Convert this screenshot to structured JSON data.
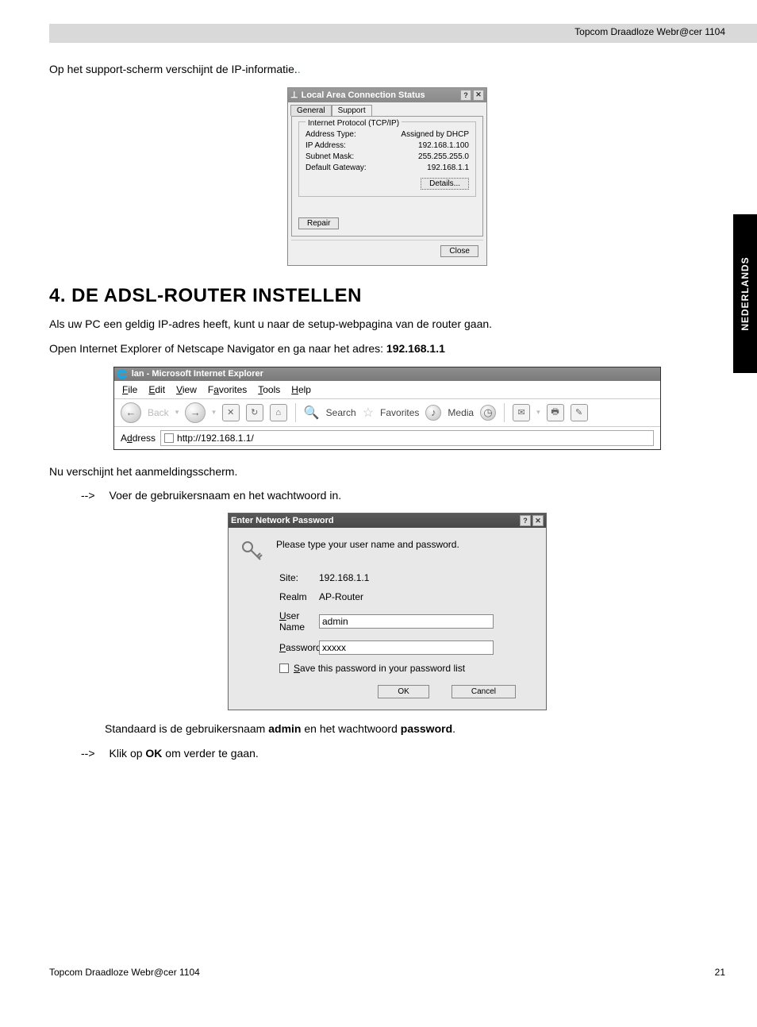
{
  "header": {
    "product": "Topcom Draadloze Webr@cer 1104"
  },
  "sideTab": "NEDERLANDS",
  "intro": {
    "support_line_a": "Op het support-scherm verschijnt de IP-informatie.",
    "support_line_dots": "."
  },
  "dlg1": {
    "title": "Local Area Connection Status",
    "tab_general": "General",
    "tab_support": "Support",
    "legend": "Internet Protocol (TCP/IP)",
    "rows": [
      {
        "k": "Address Type:",
        "v": "Assigned by DHCP"
      },
      {
        "k": "IP Address:",
        "v": "192.168.1.100"
      },
      {
        "k": "Subnet Mask:",
        "v": "255.255.255.0"
      },
      {
        "k": "Default Gateway:",
        "v": "192.168.1.1"
      }
    ],
    "details": "Details...",
    "repair": "Repair",
    "close": "Close"
  },
  "section4": {
    "heading": "4. DE ADSL-ROUTER INSTELLEN",
    "p1": "Als uw PC een geldig IP-adres heeft, kunt u naar de setup-webpagina van de router gaan.",
    "p2a": "Open Internet Explorer of Netscape Navigator en ga naar het adres: ",
    "p2b": "192.168.1.1"
  },
  "ie": {
    "title": "lan - Microsoft Internet Explorer",
    "menu": {
      "file": "File",
      "edit": "Edit",
      "view": "View",
      "favorites": "Favorites",
      "tools": "Tools",
      "help": "Help"
    },
    "toolbar": {
      "back": "Back",
      "search": "Search",
      "favorites": "Favorites",
      "media": "Media"
    },
    "address_label": "Address",
    "url": "http://192.168.1.1/"
  },
  "afterIE": {
    "p": "Nu verschijnt het aanmeldingsscherm.",
    "arrow": "-->",
    "step1": "Voer de gebruikersnaam en het wachtwoord in."
  },
  "pwd": {
    "title": "Enter Network Password",
    "prompt": "Please type your user name and password.",
    "site_l": "Site:",
    "site_v": "192.168.1.1",
    "realm_l": "Realm",
    "realm_v": "AP-Router",
    "user_l": "User Name",
    "user_v": "admin",
    "pass_l": "Password",
    "pass_v": "xxxxx",
    "save": "Save this password in your password list",
    "ok": "OK",
    "cancel": "Cancel"
  },
  "afterPwd": {
    "p_a": "Standaard is de gebruikersnaam ",
    "p_b": "admin",
    "p_c": " en het wachtwoord ",
    "p_d": "password",
    "p_e": ".",
    "arrow": "-->",
    "step2a": "Klik op ",
    "step2b": "OK",
    "step2c": " om verder te gaan."
  },
  "footer": {
    "left": "Topcom Draadloze Webr@cer 1104",
    "page": "21"
  }
}
